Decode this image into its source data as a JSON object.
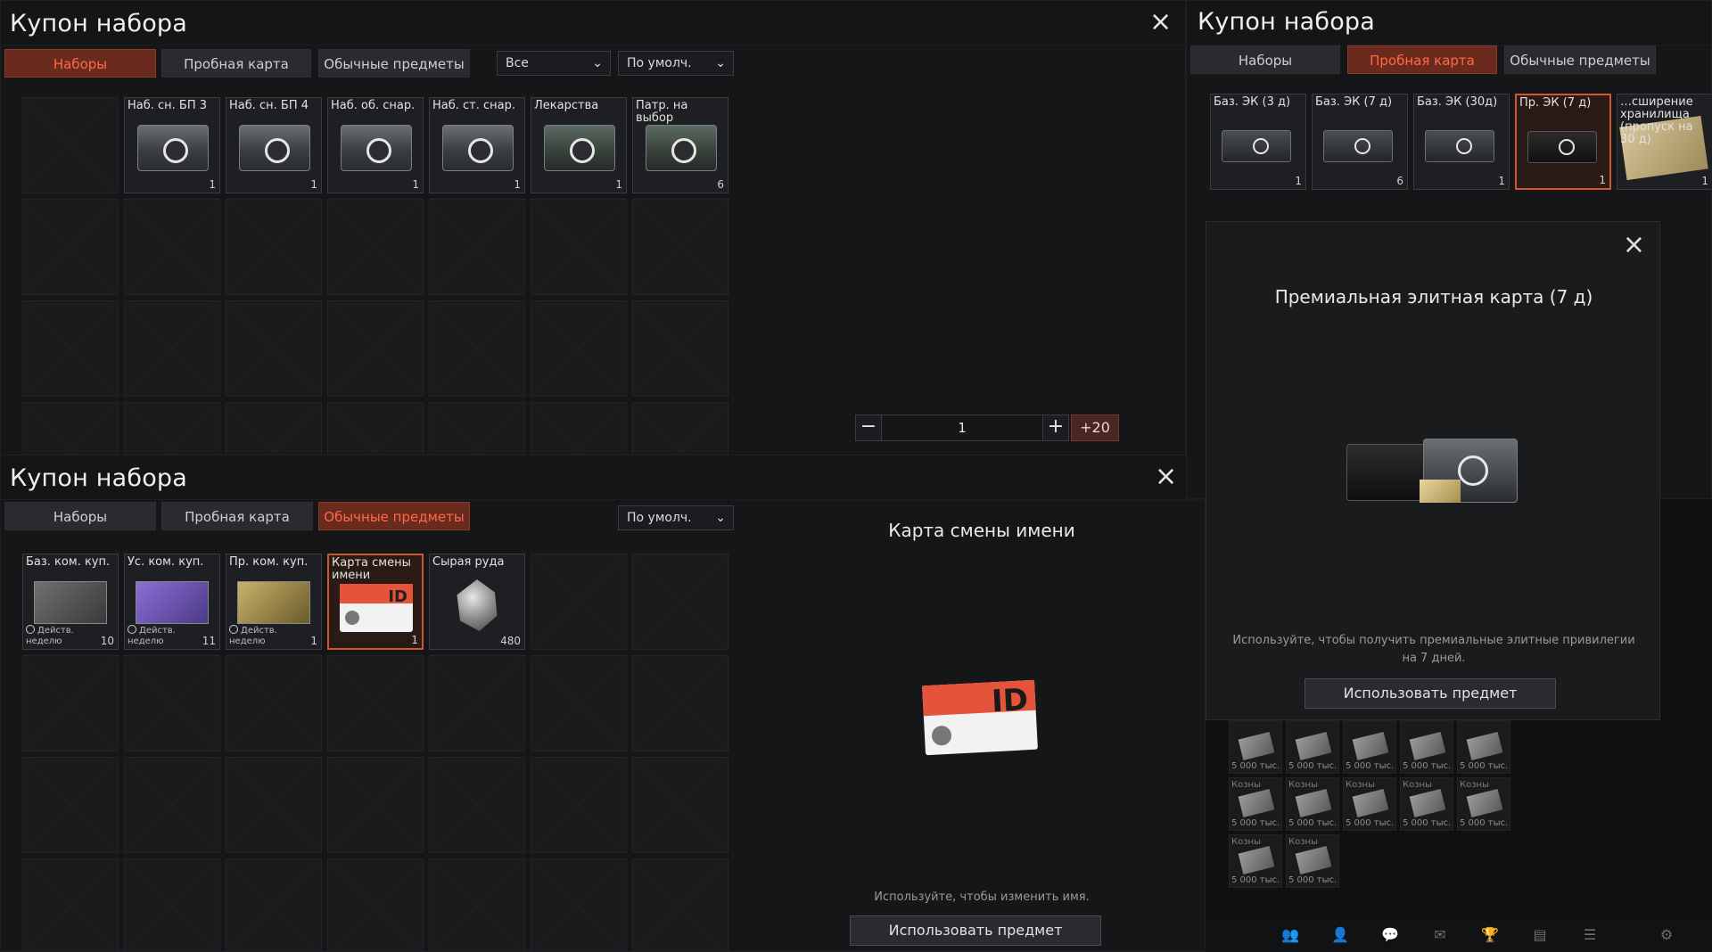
{
  "window_title": "Купон набора",
  "panel1": {
    "title": "Купон набора",
    "tabs": [
      {
        "label": "Наборы",
        "active": true
      },
      {
        "label": "Пробная карта",
        "active": false
      },
      {
        "label": "Обычные предметы",
        "active": false
      }
    ],
    "filter": {
      "value": "Все"
    },
    "sort": {
      "value": "По умолч."
    },
    "items": [
      {
        "label": "",
        "count": ""
      },
      {
        "label": "Наб. сн. БП 3",
        "count": "1"
      },
      {
        "label": "Наб. сн. БП 4",
        "count": "1"
      },
      {
        "label": "Наб. об. снар.",
        "count": "1"
      },
      {
        "label": "Наб. ст. снар.",
        "count": "1"
      },
      {
        "label": "Лекарства",
        "count": "1"
      },
      {
        "label": "Патр. на выбор",
        "count": "6"
      }
    ],
    "stepper": {
      "minus": "−",
      "value": "1",
      "plus": "+",
      "plus20": "+20"
    }
  },
  "panel2": {
    "title": "Купон набора",
    "tabs": [
      {
        "label": "Наборы",
        "active": false
      },
      {
        "label": "Пробная карта",
        "active": false
      },
      {
        "label": "Обычные предметы",
        "active": true
      }
    ],
    "sort": {
      "value": "По умолч."
    },
    "items": [
      {
        "label": "Баз. ком. куп.",
        "sub1": "Действ.",
        "sub2": "неделю",
        "count": "10"
      },
      {
        "label": "Ус. ком. куп.",
        "sub1": "Действ.",
        "sub2": "неделю",
        "count": "11"
      },
      {
        "label": "Пр. ком. куп.",
        "sub1": "Действ.",
        "sub2": "неделю",
        "count": "1"
      },
      {
        "label": "Карта смены имени",
        "count": "1",
        "selected": true
      },
      {
        "label": "Сырая руда",
        "count": "480"
      }
    ],
    "detail": {
      "title": "Карта смены имени",
      "description": "Используйте, чтобы изменить имя.",
      "use_button": "Использовать предмет"
    }
  },
  "panel3": {
    "title": "Купон набора",
    "tabs": [
      {
        "label": "Наборы",
        "active": false
      },
      {
        "label": "Пробная карта",
        "active": true
      },
      {
        "label": "Обычные предметы",
        "active": false
      }
    ],
    "items": [
      {
        "label": "Баз. ЭК (3 д)",
        "count": "1"
      },
      {
        "label": "Баз. ЭК (7 д)",
        "count": "6"
      },
      {
        "label": "Баз. ЭК (30д)",
        "count": "1"
      },
      {
        "label": "Пр. ЭК (7 д)",
        "count": "1",
        "selected": true
      },
      {
        "label": "…сширение хранилища (пропуск на 30 д)",
        "count": "1"
      }
    ],
    "dialog": {
      "title": "Премиальная элитная карта (7 д)",
      "description": "Используйте, чтобы получить премиальные элитные привилегии на 7 дней.",
      "use_button": "Использовать предмет"
    },
    "background_money": {
      "label": "5 000 тыс.",
      "top_label": "Козны"
    }
  },
  "colors": {
    "accent": "#ff6a45",
    "active_tab_bg": "#6a2a1e",
    "selected_border": "#d2562d"
  }
}
